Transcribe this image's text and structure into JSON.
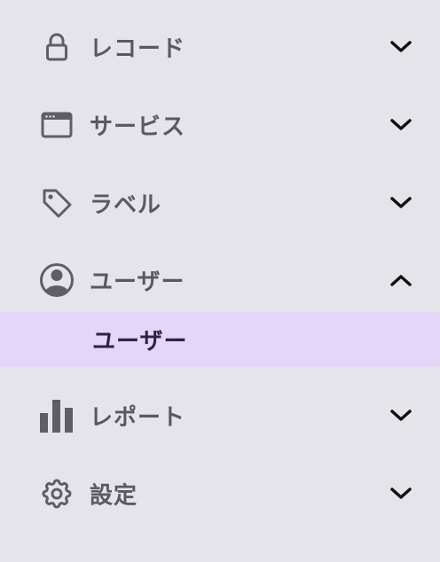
{
  "menu": {
    "items": [
      {
        "label": "レコード",
        "icon": "lock-icon",
        "expanded": false
      },
      {
        "label": "サービス",
        "icon": "browser-window-icon",
        "expanded": false
      },
      {
        "label": "ラベル",
        "icon": "tag-icon",
        "expanded": false
      },
      {
        "label": "ユーザー",
        "icon": "user-circle-icon",
        "expanded": true,
        "children": [
          {
            "label": "ユーザー",
            "selected": true
          }
        ]
      },
      {
        "label": "レポート",
        "icon": "bar-chart-icon",
        "expanded": false
      },
      {
        "label": "設定",
        "icon": "gear-icon",
        "expanded": false
      }
    ]
  },
  "colors": {
    "background": "#e5e4ea",
    "selected_background": "#e3d6f9",
    "icon": "#5f5d68",
    "label": "#5a5862",
    "selected_label": "#2c2340",
    "chevron": "#111111"
  }
}
